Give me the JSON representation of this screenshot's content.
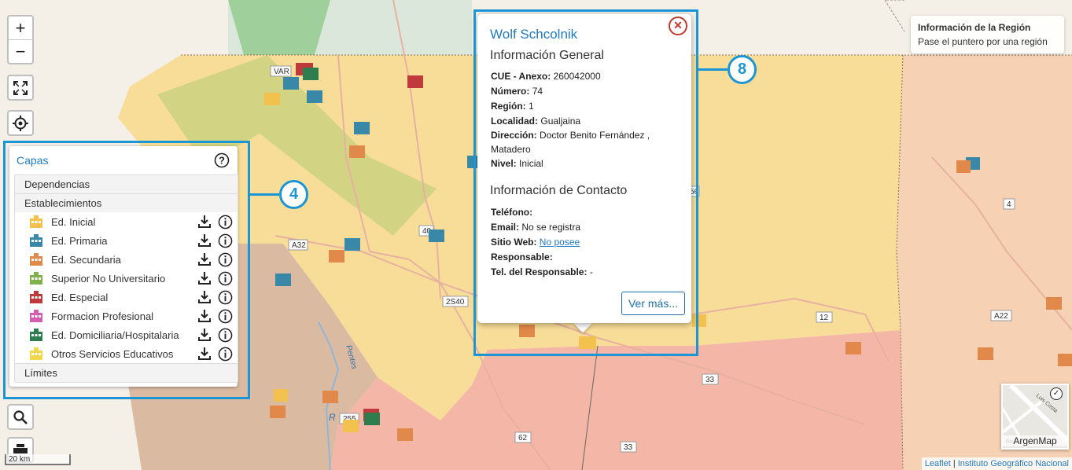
{
  "map": {
    "place_labels": [
      "VAR",
      "A32",
      "40",
      "2S40",
      "255",
      "12",
      "33",
      "33",
      "62",
      "A22",
      "4",
      "56"
    ],
    "river_label": "R",
    "river_label2": "Pentes"
  },
  "controls": {
    "zoom_in": "+",
    "zoom_out": "−",
    "fullscreen_icon": "fullscreen-icon",
    "locate_icon": "crosshair-icon",
    "search_icon": "search-icon",
    "print_icon": "printer-icon"
  },
  "layers_panel": {
    "title": "Capas",
    "section_dependencias": "Dependencias",
    "section_establecimientos": "Establecimientos",
    "section_limites": "Límites",
    "layers": [
      {
        "label": "Ed. Inicial",
        "color": "#f2c14e"
      },
      {
        "label": "Ed. Primaria",
        "color": "#3a88a8"
      },
      {
        "label": "Ed. Secundaria",
        "color": "#e0894a"
      },
      {
        "label": "Superior No Universitario",
        "color": "#7fb24a"
      },
      {
        "label": "Ed. Especial",
        "color": "#c0393b"
      },
      {
        "label": "Formacion Profesional",
        "color": "#d35fb0"
      },
      {
        "label": "Ed. Domiciliaria/Hospitalaria",
        "color": "#2e7d4f"
      },
      {
        "label": "Otros Servicios Educativos",
        "color": "#f0d84a"
      }
    ]
  },
  "annotations": {
    "badge_layers": "4",
    "badge_popup": "8"
  },
  "popup": {
    "school_name": "Wolf Schcolnik",
    "general_heading": "Información General",
    "cue_label": "CUE - Anexo:",
    "cue_value": "260042000",
    "numero_label": "Número:",
    "numero_value": "74",
    "region_label": "Región:",
    "region_value": "1",
    "localidad_label": "Localidad:",
    "localidad_value": "Gualjaina",
    "direccion_label": "Dirección:",
    "direccion_value": "Doctor Benito Fernández , Matadero",
    "nivel_label": "Nivel:",
    "nivel_value": "Inicial",
    "contact_heading": "Información de Contacto",
    "telefono_label": "Teléfono:",
    "telefono_value": "",
    "email_label": "Email:",
    "email_value": "No se registra",
    "web_label": "Sitio Web:",
    "web_value": "No posee",
    "responsable_label": "Responsable:",
    "responsable_value": "",
    "tel_resp_label": "Tel. del Responsable:",
    "tel_resp_value": "-",
    "more_button": "Ver más..."
  },
  "region_info": {
    "title": "Información de la Región",
    "hint": "Pase el puntero por una región"
  },
  "scale": {
    "label": "20 km"
  },
  "minimap": {
    "label": "ArgenMap",
    "road_label": "Luis Costa",
    "road_label2": "Ru"
  },
  "attribution": {
    "leaflet": "Leaflet",
    "separator": " | ",
    "ign": "Instituto Geográfico Nacional"
  }
}
